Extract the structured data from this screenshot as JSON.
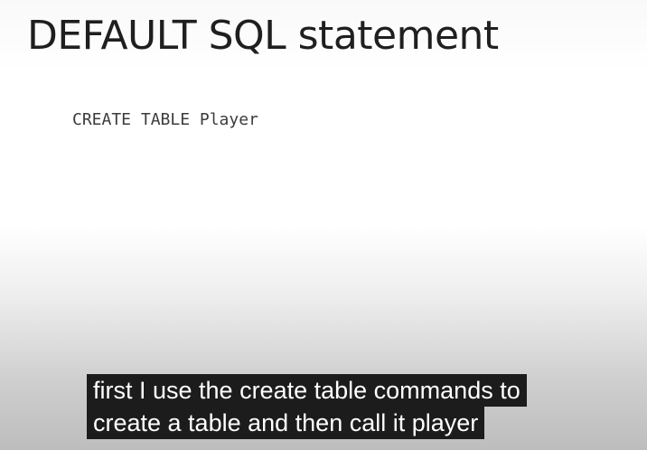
{
  "slide": {
    "title": "DEFAULT SQL statement",
    "code": "CREATE TABLE Player"
  },
  "captions": {
    "line1": "first I use the create table commands to",
    "line2": "create a table and then call it player"
  }
}
